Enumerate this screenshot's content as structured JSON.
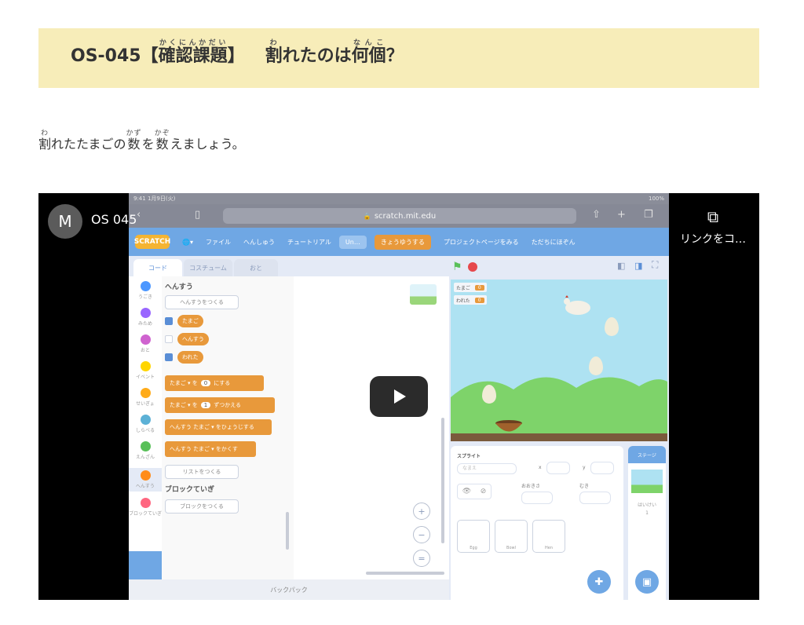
{
  "header": {
    "code": "OS-045【",
    "w1": "確認課題",
    "w1_ruby": "かくにんかだい",
    "close": "】",
    "w2": "割",
    "w2_ruby": "わ",
    "mid": "れたのは",
    "w3": "何個",
    "w3_ruby": "なんこ",
    "end": "？"
  },
  "instruction": {
    "w1": "割",
    "w1_ruby": "わ",
    "t1": "れたたまごの",
    "w2": "数",
    "w2_ruby": "かず",
    "t2": "を",
    "w3": "数",
    "w3_ruby": "かぞ",
    "t3": "えましょう。"
  },
  "video": {
    "channel_initial": "M",
    "title": "OS 045",
    "copy_link_label": "リンクをコ…",
    "colors": {
      "youtube_bg": "#000000",
      "header_bg": "#f7edb9",
      "scratch_blue": "#6fa7e4",
      "scratch_orange": "#e8993b"
    },
    "ios": {
      "time": "9:41 1月9日(火)",
      "battery": "100%",
      "url": "scratch.mit.edu"
    },
    "scratch": {
      "logo": "SCRATCH",
      "menu": [
        "ファイル",
        "へんしゅう",
        "チュートリアル",
        "Un…",
        "きょうゆうする",
        "プロジェクトページをみる",
        "ただちにほぞん"
      ],
      "tabs": [
        "コード",
        "コスチューム",
        "おと"
      ],
      "categories": [
        {
          "label": "うごき",
          "color": "#4c97ff"
        },
        {
          "label": "みため",
          "color": "#9966ff"
        },
        {
          "label": "おと",
          "color": "#cf63cf"
        },
        {
          "label": "イベント",
          "color": "#ffd500"
        },
        {
          "label": "せいぎょ",
          "color": "#ffab19"
        },
        {
          "label": "しらべる",
          "color": "#5cb1d6"
        },
        {
          "label": "えんざん",
          "color": "#59c059"
        },
        {
          "label": "へんすう",
          "color": "#ff8c1a"
        },
        {
          "label": "ブロックていぎ",
          "color": "#ff6680"
        }
      ],
      "palette": {
        "heading": "へんすう",
        "make_variable": "へんすうをつくる",
        "variables": [
          {
            "name": "たまご",
            "checked": true
          },
          {
            "name": "へんすう",
            "checked": false
          },
          {
            "name": "われた",
            "checked": true
          }
        ],
        "blocks": [
          {
            "pre": "たまご ▾ を",
            "num": "0",
            "post": "にする"
          },
          {
            "pre": "たまご ▾ を",
            "num": "1",
            "post": "ずつかえる"
          },
          {
            "pre": "へんすう たまご ▾ をひょうじする",
            "num": "",
            "post": ""
          },
          {
            "pre": "へんすう たまご ▾ をかくす",
            "num": "",
            "post": ""
          }
        ],
        "make_list": "リストをつくる",
        "my_blocks_heading": "ブロックていぎ",
        "make_block": "ブロックをつくる"
      },
      "zoom": [
        "+",
        "−",
        "="
      ],
      "backpack": "バックパック",
      "monitors": [
        {
          "label": "たまご",
          "value": "0"
        },
        {
          "label": "われた",
          "value": "0"
        }
      ],
      "sprite_panel": {
        "label": "スプライト",
        "name_placeholder": "なまえ",
        "x": "x",
        "y": "y",
        "size": "おおきさ",
        "direction": "むき",
        "sprites": [
          "Egg",
          "Bowl",
          "Hen"
        ]
      },
      "stage_panel": {
        "label": "ステージ",
        "backdrops_label": "はいけい",
        "backdrops_count": "1"
      }
    }
  }
}
